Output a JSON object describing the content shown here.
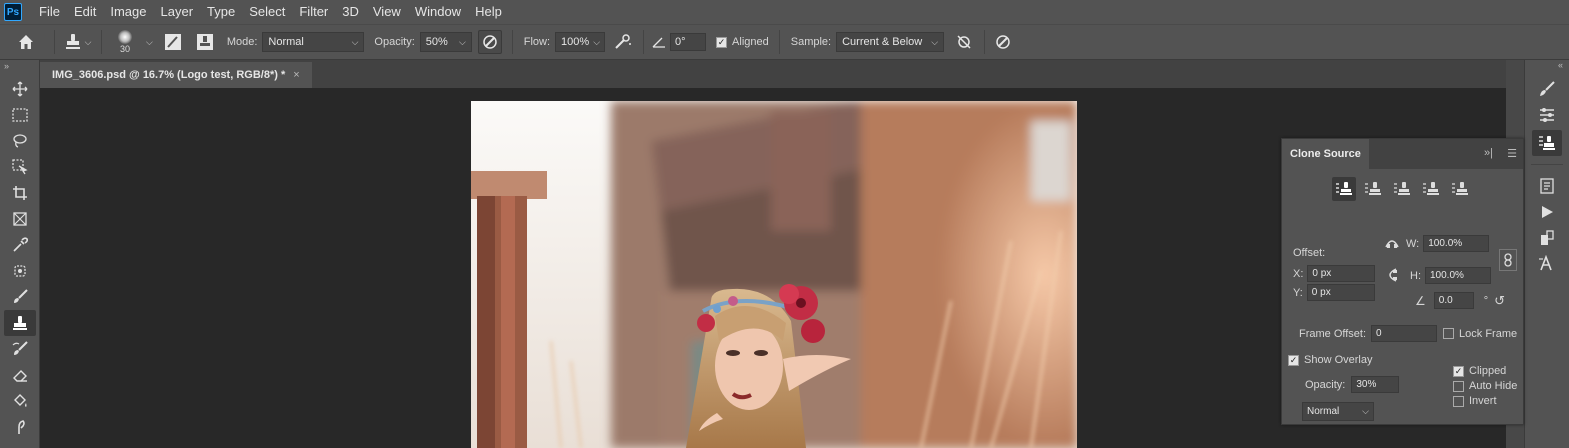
{
  "app": {
    "logo": "Ps"
  },
  "menu": [
    "File",
    "Edit",
    "Image",
    "Layer",
    "Type",
    "Select",
    "Filter",
    "3D",
    "View",
    "Window",
    "Help"
  ],
  "options": {
    "brush_size": "30",
    "mode_label": "Mode:",
    "mode_value": "Normal",
    "opacity_label": "Opacity:",
    "opacity_value": "50%",
    "flow_label": "Flow:",
    "flow_value": "100%",
    "angle_value": "0°",
    "aligned_label": "Aligned",
    "sample_label": "Sample:",
    "sample_value": "Current & Below"
  },
  "document": {
    "tab_title": "IMG_3606.psd @ 16.7% (Logo test, RGB/8*) *",
    "tab_close": "×"
  },
  "clone_source": {
    "title": "Clone Source",
    "offset_label": "Offset:",
    "x_label": "X:",
    "x_value": "0 px",
    "y_label": "Y:",
    "y_value": "0 px",
    "w_label": "W:",
    "w_value": "100.0%",
    "h_label": "H:",
    "h_value": "100.0%",
    "angle_value": "0.0",
    "angle_unit": "°",
    "frame_offset_label": "Frame Offset:",
    "frame_offset_value": "0",
    "lock_frame_label": "Lock Frame",
    "show_overlay_label": "Show Overlay",
    "overlay_opacity_label": "Opacity:",
    "overlay_opacity_value": "30%",
    "overlay_mode_value": "Normal",
    "clipped_label": "Clipped",
    "auto_hide_label": "Auto Hide",
    "invert_label": "Invert"
  },
  "colors": {
    "ui_bg": "#535353",
    "canvas_bg": "#282828",
    "accent": "#31a8ff"
  }
}
